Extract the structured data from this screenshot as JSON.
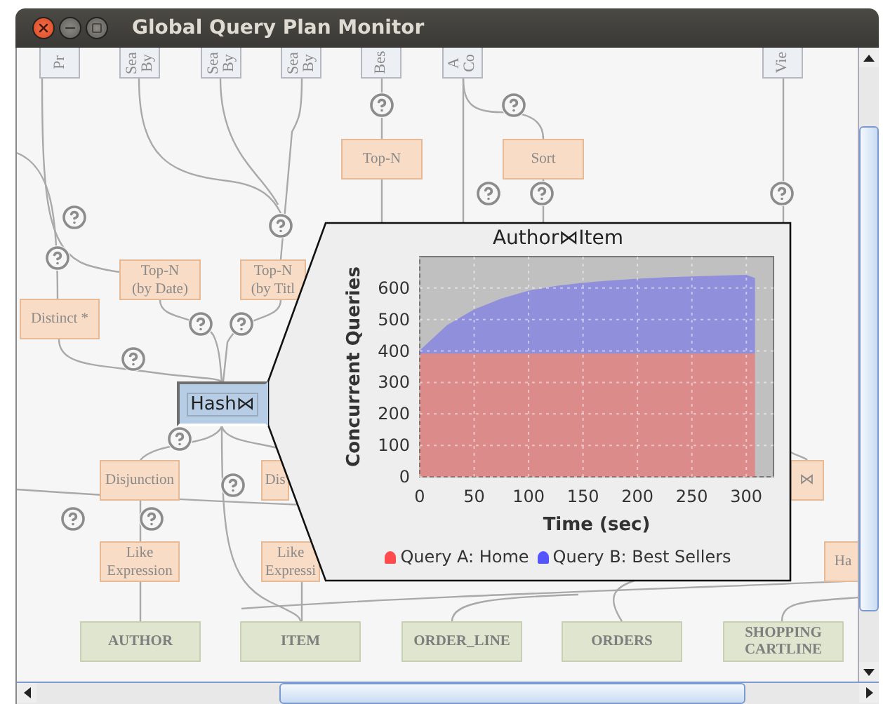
{
  "window": {
    "title": "Global Query Plan Monitor"
  },
  "diagram": {
    "nodes": [
      {
        "kind": "source",
        "label": "Pr",
        "selected": false
      },
      {
        "kind": "source",
        "label": "Sea\nBy",
        "selected": false
      },
      {
        "kind": "source",
        "label": "Sea\nBy",
        "selected": false
      },
      {
        "kind": "source",
        "label": "Sea\nBy",
        "selected": false
      },
      {
        "kind": "source",
        "label": "Bes",
        "selected": false
      },
      {
        "kind": "source",
        "label": "A\nCo",
        "selected": false
      },
      {
        "kind": "source",
        "label": "Vie",
        "selected": false
      },
      {
        "kind": "operator",
        "label": "Top-N",
        "selected": false
      },
      {
        "kind": "operator",
        "label": "Sort",
        "selected": false
      },
      {
        "kind": "operator",
        "label": "Top-N\n(by Date)",
        "selected": false
      },
      {
        "kind": "operator",
        "label": "Top-N\n(by Titl",
        "selected": false
      },
      {
        "kind": "operator",
        "label": "Distinct *",
        "selected": false
      },
      {
        "kind": "operator",
        "label": "Hash⋈",
        "selected": true
      },
      {
        "kind": "operator",
        "label": "Disjunction",
        "selected": false
      },
      {
        "kind": "operator",
        "label": "Dis",
        "selected": false
      },
      {
        "kind": "operator",
        "label": "⋈",
        "selected": false
      },
      {
        "kind": "operator",
        "label": "Like\nExpression",
        "selected": false
      },
      {
        "kind": "operator",
        "label": "Like\nExpressi",
        "selected": false
      },
      {
        "kind": "operator",
        "label": "Ha",
        "selected": false
      },
      {
        "kind": "table",
        "label": "AUTHOR",
        "selected": false
      },
      {
        "kind": "table",
        "label": "ITEM",
        "selected": false
      },
      {
        "kind": "table",
        "label": "ORDER_LINE",
        "selected": false
      },
      {
        "kind": "table",
        "label": "ORDERS",
        "selected": false
      },
      {
        "kind": "table",
        "label": "SHOPPING CARTLINE",
        "selected": false
      }
    ],
    "popup": {
      "title": "Author⋈Item",
      "chart_data": {
        "type": "area",
        "stacked": true,
        "xlabel": "Time (sec)",
        "ylabel": "Concurrent Queries",
        "x": [
          0,
          25,
          50,
          75,
          100,
          125,
          150,
          175,
          200,
          225,
          250,
          275,
          300,
          308
        ],
        "series": [
          {
            "name": "Query A: Home",
            "color": "#ff4b4b",
            "values": [
              392,
              392,
              392,
              392,
              392,
              392,
              392,
              392,
              392,
              392,
              392,
              392,
              392,
              392
            ]
          },
          {
            "name": "Query B: Best Sellers",
            "color": "#5555ff",
            "values": [
              10,
              90,
              140,
              175,
              200,
              215,
              225,
              232,
              238,
              242,
              245,
              248,
              250,
              240
            ]
          }
        ],
        "grid": true,
        "xlim": [
          0,
          325
        ],
        "ylim": [
          0,
          700
        ],
        "xticks": [
          0,
          50,
          100,
          150,
          200,
          250,
          300
        ],
        "yticks": [
          0,
          100,
          200,
          300,
          400,
          500,
          600
        ]
      }
    }
  }
}
